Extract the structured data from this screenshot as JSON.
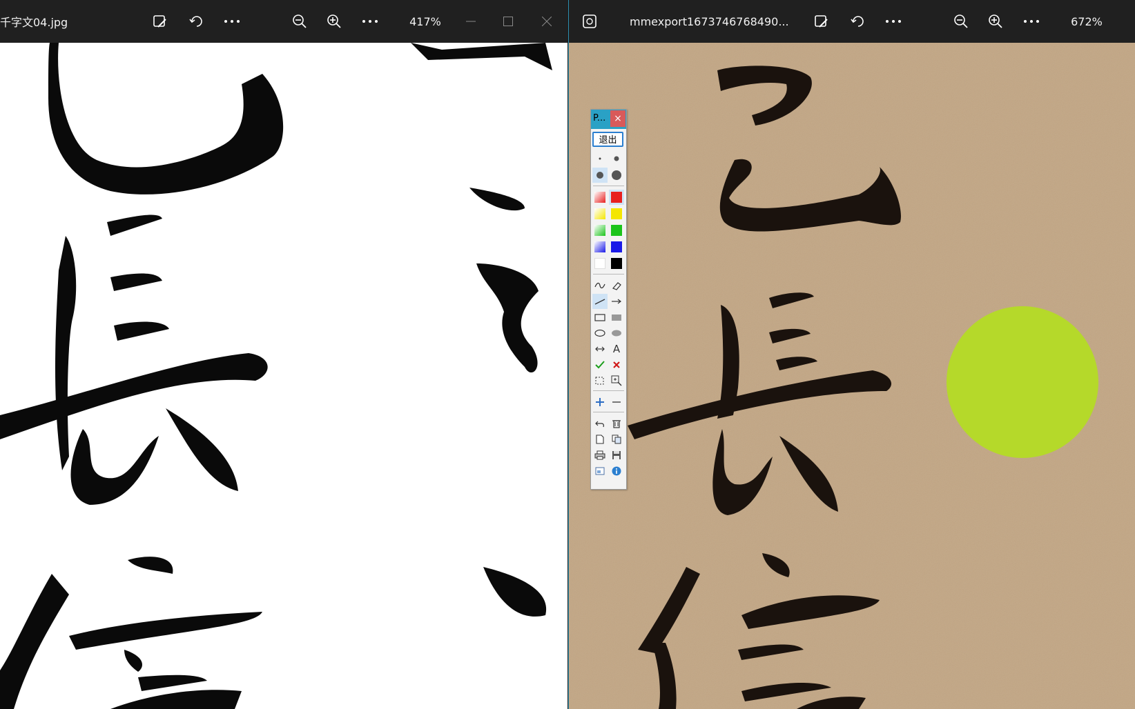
{
  "left_window": {
    "filename": "千字文04.jpg",
    "zoom": "417%",
    "icons": [
      "edit-image-icon",
      "rotate-icon",
      "more-icon",
      "zoom-out-icon",
      "zoom-in-icon",
      "more-icon"
    ]
  },
  "right_window": {
    "filename": "mmexport1673746768490...",
    "zoom": "672%"
  },
  "pen_palette": {
    "title": "P...",
    "close": "×",
    "exit_label": "退出",
    "text_tool": "A",
    "colors": {
      "red": "#e82020",
      "yellow": "#f4e600",
      "green": "#1bc41b",
      "blue": "#1a1ae8",
      "white": "#ffffff",
      "black": "#000000",
      "accent": "#2aa1c5",
      "highlighter_dot": "#b5d92a"
    }
  }
}
